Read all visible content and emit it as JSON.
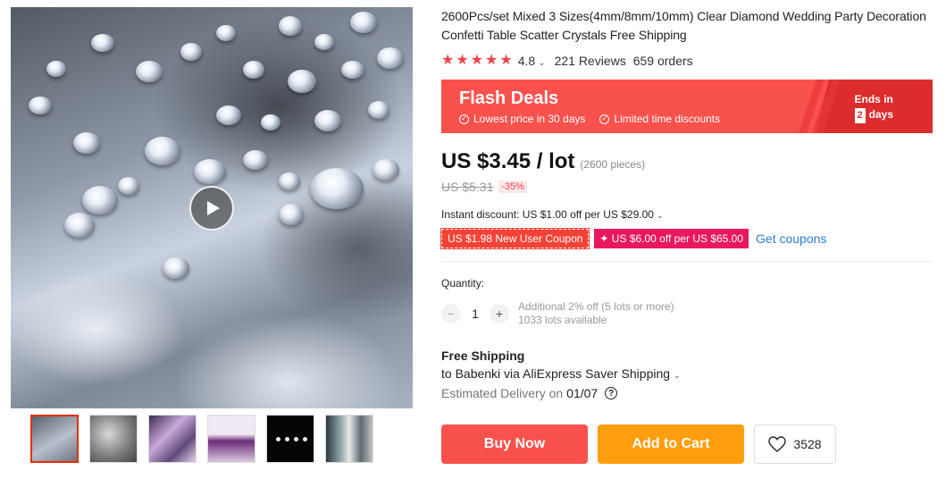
{
  "product": {
    "title": "2600Pcs/set Mixed 3 Sizes(4mm/8mm/10mm) Clear Diamond Wedding Party Decoration Confetti Table Scatter Crystals Free Shipping",
    "rating": "4.8",
    "reviews": "221 Reviews",
    "orders": "659 orders"
  },
  "flash": {
    "title": "Flash Deals",
    "benefit_1": "Lowest price in 30 days",
    "benefit_2": "Limited time discounts",
    "ends_label": "Ends in",
    "days_count": "2",
    "days_label": "days"
  },
  "price": {
    "current": "US $3.45 / lot",
    "pieces": "(2600 pieces)",
    "original": "US $5.31",
    "discount": "-35%"
  },
  "coupons": {
    "instant": "Instant discount: US $1.00 off per US $29.00",
    "new_user": "US $1.98 New User Coupon",
    "store": "✦ US $6.00 off per US $65.00",
    "get": "Get coupons"
  },
  "quantity": {
    "label": "Quantity:",
    "value": "1",
    "additional": "Additional 2% off (5 lots or more)",
    "available": "1033 lots available"
  },
  "shipping": {
    "title": "Free Shipping",
    "to": "to Babenki via AliExpress Saver Shipping",
    "estimated_label": "Estimated Delivery on",
    "estimated_date": "01/07",
    "help": "?"
  },
  "actions": {
    "buy": "Buy Now",
    "cart": "Add to Cart",
    "wishlist_count": "3528"
  },
  "icons": {
    "play": "play-icon",
    "star": "star-icon",
    "heart": "heart-icon",
    "check": "check-circle-icon",
    "chevron": "chevron-down-icon"
  },
  "colors": {
    "accent_red": "#f9514c",
    "cart_orange": "#ff9e0e",
    "coupon_pink": "#e8185e",
    "link_blue": "#2e7bd6"
  }
}
